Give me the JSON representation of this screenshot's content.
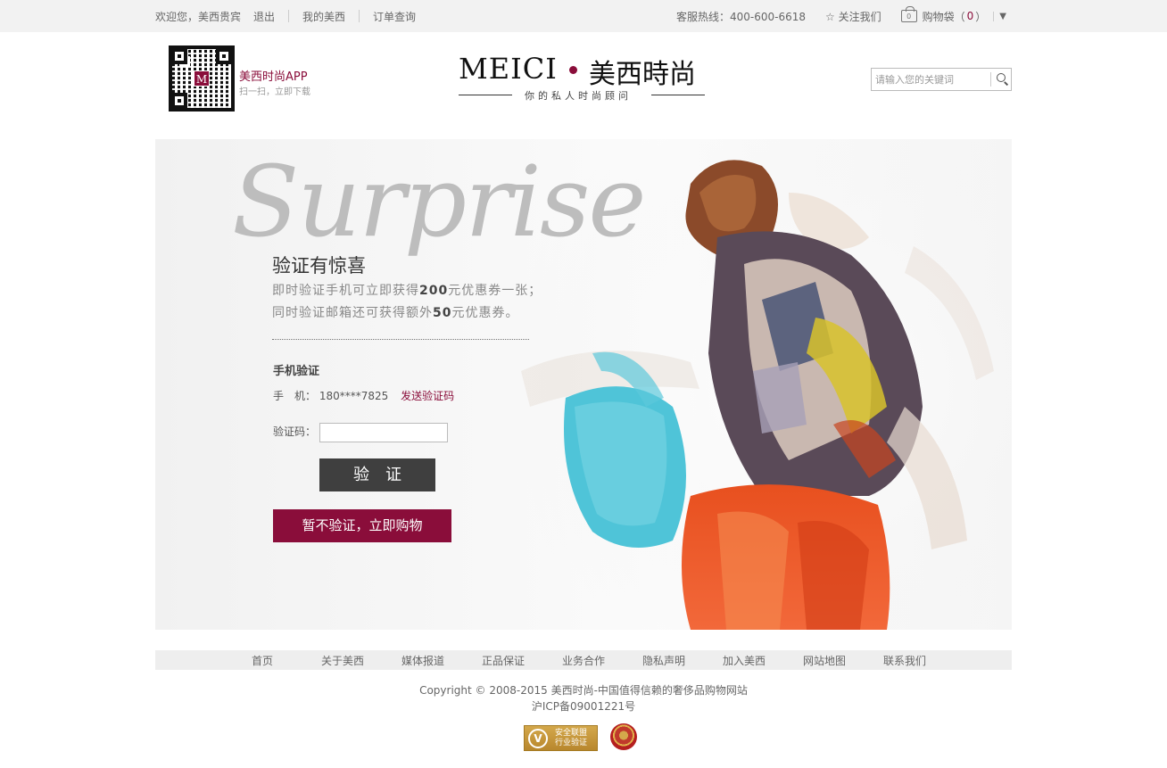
{
  "topbar": {
    "welcome": "欢迎您，美西贵宾",
    "logout": "退出",
    "my_meici": "我的美西",
    "order_query": "订单查询",
    "hotline": "客服热线：400-600-6618",
    "follow": "☆ 关注我们",
    "bag_label": "购物袋",
    "bag_open": "（",
    "bag_count": "0",
    "bag_close": "）",
    "bag_icon_count": "0",
    "dropdown_caret": "▼"
  },
  "header": {
    "qr_badge": "M",
    "app_title": "美西时尚APP",
    "app_sub": "扫一扫，立即下载",
    "logo_en": "MEICI",
    "logo_cn": "美西時尚",
    "logo_slogan": "你的私人时尚顾问",
    "search_placeholder": "请输入您的关键词"
  },
  "banner": {
    "surprise": "Surprise",
    "title": "验证有惊喜",
    "line1_a": "即时验证手机可立即获得",
    "line1_b": "200",
    "line1_c": "元优惠券一张；",
    "line2_a": "同时验证邮箱还可获得额外",
    "line2_b": "50",
    "line2_c": "元优惠券。",
    "section_title": "手机验证",
    "phone_label": "手　机：",
    "phone_value": "180****7825",
    "send_code": "发送验证码",
    "code_label": "验证码：",
    "verify_button": "验证",
    "skip_button": "暂不验证，立即购物"
  },
  "footer": {
    "nav": [
      "首页",
      "关于美西",
      "媒体报道",
      "正品保证",
      "业务合作",
      "隐私声明",
      "加入美西",
      "网站地图",
      "联系我们"
    ],
    "copyright": "Copyright © 2008-2015 美西时尚-中国值得信赖的奢侈品购物网站",
    "icp": "沪ICP备09001221号",
    "badge_v": "V",
    "badge_line1": "安全联盟",
    "badge_line2": "行业验证"
  },
  "colors": {
    "brand": "#8a0d3a",
    "verify_button": "#3f3f3f",
    "topbar_bg": "#f2f2f2"
  }
}
